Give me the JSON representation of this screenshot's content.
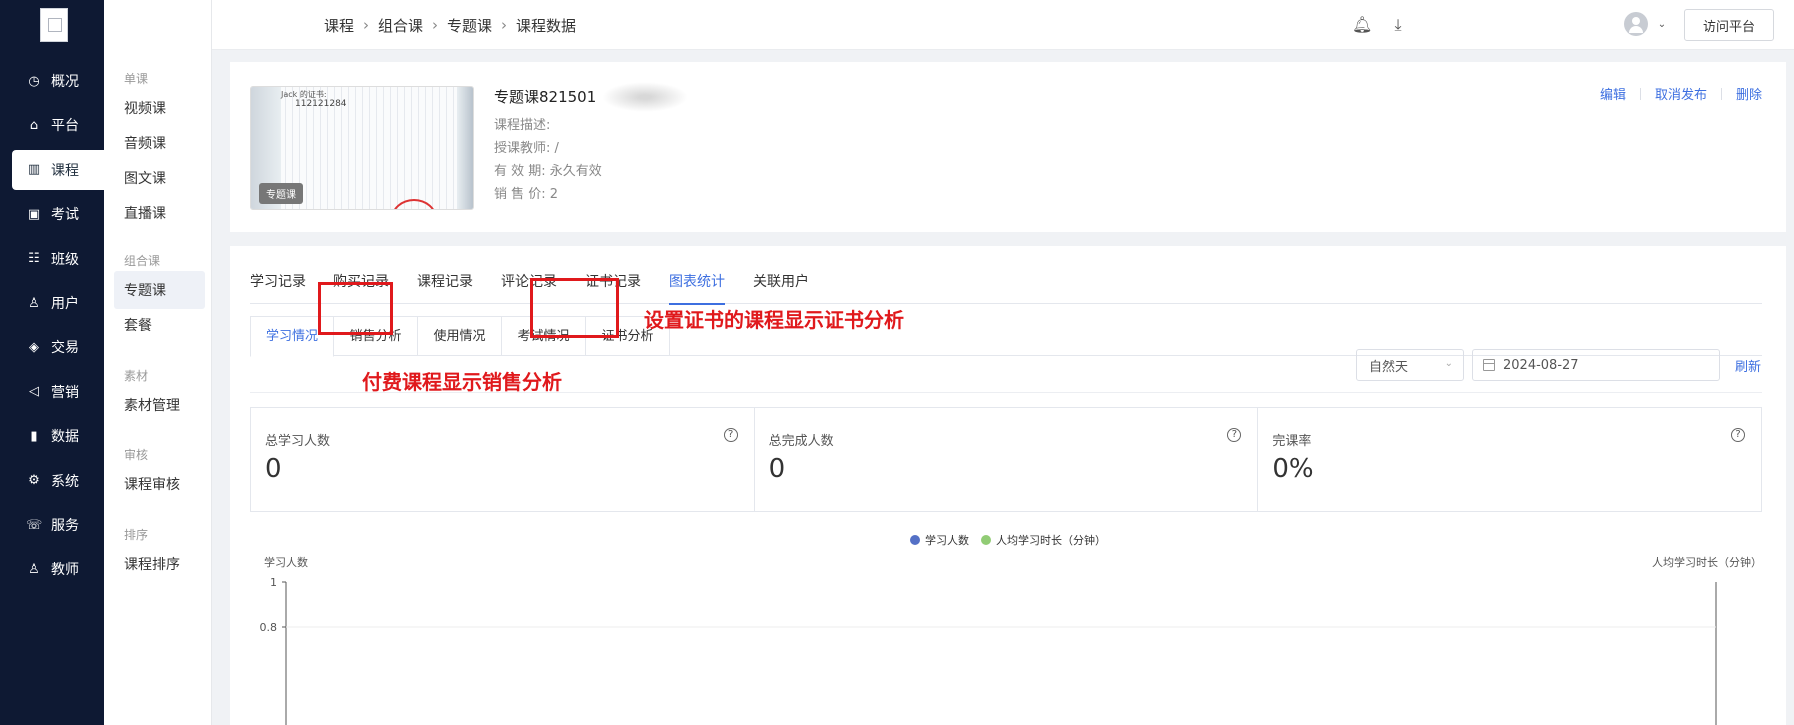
{
  "sidebar": {
    "items": [
      {
        "icon": "clock-icon",
        "glyph": "◷",
        "label": "概况"
      },
      {
        "icon": "store-icon",
        "glyph": "⌂",
        "label": "平台"
      },
      {
        "icon": "book-icon",
        "glyph": "▥",
        "label": "课程"
      },
      {
        "icon": "exam-icon",
        "glyph": "▣",
        "label": "考试"
      },
      {
        "icon": "class-icon",
        "glyph": "☷",
        "label": "班级"
      },
      {
        "icon": "user-icon",
        "glyph": "♙",
        "label": "用户"
      },
      {
        "icon": "trade-icon",
        "glyph": "◈",
        "label": "交易"
      },
      {
        "icon": "megaphone-icon",
        "glyph": "◁",
        "label": "营销"
      },
      {
        "icon": "data-icon",
        "glyph": "▮",
        "label": "数据"
      },
      {
        "icon": "settings-icon",
        "glyph": "⚙",
        "label": "系统"
      },
      {
        "icon": "service-icon",
        "glyph": "☏",
        "label": "服务"
      },
      {
        "icon": "teacher-icon",
        "glyph": "♙",
        "label": "教师"
      }
    ],
    "active": "课程"
  },
  "submenu": {
    "groups": [
      {
        "title": "单课",
        "items": [
          "视频课",
          "音频课",
          "图文课",
          "直播课"
        ]
      },
      {
        "title": "组合课",
        "items": [
          "专题课",
          "套餐"
        ]
      },
      {
        "title": "素材",
        "items": [
          "素材管理"
        ]
      },
      {
        "title": "审核",
        "items": [
          "课程审核"
        ]
      },
      {
        "title": "排序",
        "items": [
          "课程排序"
        ]
      }
    ],
    "active": "专题课"
  },
  "header": {
    "breadcrumb": [
      "课程",
      "组合课",
      "专题课",
      "课程数据"
    ],
    "icons": [
      "bell-icon",
      "download-icon",
      "avatar"
    ],
    "visit_label": "访问平台"
  },
  "course": {
    "title": "专题课821501",
    "thumb_badge": "专题课",
    "thumb_text1": "Jack 的证书:",
    "thumb_text2": "112121284",
    "desc_label": "课程描述:",
    "desc_value": "",
    "teacher_label": "授课教师:",
    "teacher_value": "/",
    "validity_label": "有 效 期:",
    "validity_value": "永久有效",
    "price_label": "销 售 价:",
    "price_value": "2",
    "actions": [
      "编辑",
      "取消发布",
      "删除"
    ]
  },
  "tabs": {
    "main": [
      "学习记录",
      "购买记录",
      "课程记录",
      "评论记录",
      "证书记录",
      "图表统计",
      "关联用户"
    ],
    "main_active": "图表统计",
    "sub": [
      "学习情况",
      "销售分析",
      "使用情况",
      "考试情况",
      "证书分析"
    ],
    "sub_active": "学习情况"
  },
  "annotations": {
    "cert": "设置证书的课程显示证书分析",
    "sales": "付费课程显示销售分析",
    "color": "#e0191c"
  },
  "filters": {
    "period": "自然天",
    "date": "2024-08-27",
    "refresh": "刷新"
  },
  "stats": [
    {
      "label": "总学习人数",
      "value": "0"
    },
    {
      "label": "总完成人数",
      "value": "0"
    },
    {
      "label": "完课率",
      "value": "0%"
    }
  ],
  "chart_data": {
    "type": "line",
    "title": "",
    "series": [
      {
        "name": "学习人数",
        "color": "#5470c6",
        "values": []
      },
      {
        "name": "人均学习时长（分钟）",
        "color": "#91cc75",
        "values": []
      }
    ],
    "ylabel": "学习人数",
    "y2label": "人均学习时长（分钟）",
    "yticks": [
      "1",
      "0.8"
    ],
    "ylim": [
      0,
      1
    ]
  },
  "colors": {
    "accent": "#3d6fe0",
    "sidebar": "#0e1933"
  }
}
